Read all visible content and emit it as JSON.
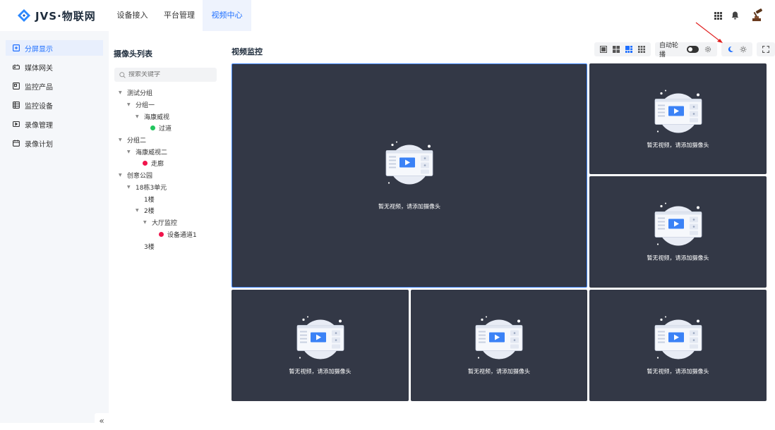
{
  "app": {
    "logo_text": "JVS·物联网"
  },
  "nav": {
    "items": [
      {
        "label": "设备接入",
        "active": false
      },
      {
        "label": "平台管理",
        "active": false
      },
      {
        "label": "视频中心",
        "active": true
      }
    ]
  },
  "sidebar": {
    "items": [
      {
        "label": "分屏显示",
        "icon": "split-screen-icon",
        "active": true
      },
      {
        "label": "媒体网关",
        "icon": "gateway-icon",
        "active": false
      },
      {
        "label": "监控产品",
        "icon": "product-icon",
        "active": false
      },
      {
        "label": "监控设备",
        "icon": "device-icon",
        "active": false
      },
      {
        "label": "录像管理",
        "icon": "record-icon",
        "active": false
      },
      {
        "label": "录像计划",
        "icon": "calendar-icon",
        "active": false
      }
    ],
    "collapse_label": "«"
  },
  "tree": {
    "title": "摄像头列表",
    "search_placeholder": "搜索关键字",
    "nodes": [
      {
        "label": "测试分组",
        "level": 0,
        "caret": true
      },
      {
        "label": "分组一",
        "level": 1,
        "caret": true
      },
      {
        "label": "海康威视",
        "level": 2,
        "caret": true
      },
      {
        "label": "过道",
        "level": 3,
        "status": "online"
      },
      {
        "label": "分组二",
        "level": 0,
        "caret": true
      },
      {
        "label": "海康威视二",
        "level": 1,
        "caret": true
      },
      {
        "label": "走廊",
        "level": 2,
        "status": "offline"
      },
      {
        "label": "创意公园",
        "level": 0,
        "caret": true
      },
      {
        "label": "18栋3单元",
        "level": 1,
        "caret": true
      },
      {
        "label": "1楼",
        "level": 2,
        "caret": false
      },
      {
        "label": "2楼",
        "level": 2,
        "caret": true
      },
      {
        "label": "大厅监控",
        "level": 3,
        "caret": true
      },
      {
        "label": "设备通道1",
        "level": 4,
        "status": "offline"
      },
      {
        "label": "3楼",
        "level": 2,
        "caret": false
      }
    ]
  },
  "main": {
    "title": "视频监控",
    "auto_rotate_label": "自动轮播",
    "auto_rotate_on": false,
    "empty_text": "暂无视频，请添加摄像头"
  },
  "colors": {
    "accent": "#1e6fff",
    "cell_bg": "#333846",
    "online": "#22c55e",
    "offline": "#f0144b"
  }
}
